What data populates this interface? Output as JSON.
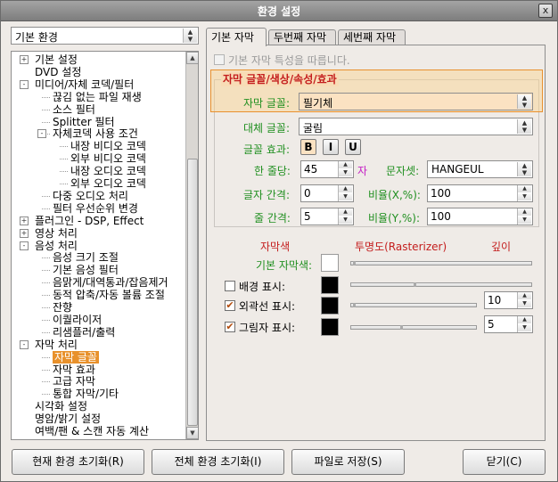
{
  "window": {
    "title": "환경 설정",
    "close_label": "x"
  },
  "category_combo": {
    "value": "기본 환경"
  },
  "tree": {
    "items": [
      {
        "label": "기본 설정",
        "level": 0,
        "expander": "+"
      },
      {
        "label": "DVD 설정",
        "level": 0,
        "expander": ""
      },
      {
        "label": "미디어/자체 코덱/필터",
        "level": 0,
        "expander": "-"
      },
      {
        "label": "끊김 없는 파일 재생",
        "level": 1,
        "expander": ""
      },
      {
        "label": "소스 필터",
        "level": 1,
        "expander": ""
      },
      {
        "label": "Splitter 필터",
        "level": 1,
        "expander": ""
      },
      {
        "label": "자체코덱 사용 조건",
        "level": 1,
        "expander": "-"
      },
      {
        "label": "내장 비디오 코덱",
        "level": 2,
        "expander": ""
      },
      {
        "label": "외부 비디오 코덱",
        "level": 2,
        "expander": ""
      },
      {
        "label": "내장 오디오 코덱",
        "level": 2,
        "expander": ""
      },
      {
        "label": "외부 오디오 코덱",
        "level": 2,
        "expander": ""
      },
      {
        "label": "다중 오디오 처리",
        "level": 1,
        "expander": ""
      },
      {
        "label": "필터 우선순위 변경",
        "level": 1,
        "expander": ""
      },
      {
        "label": "플러그인 - DSP, Effect",
        "level": 0,
        "expander": "+"
      },
      {
        "label": "영상 처리",
        "level": 0,
        "expander": "+"
      },
      {
        "label": "음성 처리",
        "level": 0,
        "expander": "-"
      },
      {
        "label": "음성 크기 조절",
        "level": 1,
        "expander": ""
      },
      {
        "label": "기본 음성 필터",
        "level": 1,
        "expander": ""
      },
      {
        "label": "음맑게/대역통과/잡음제거",
        "level": 1,
        "expander": ""
      },
      {
        "label": "동적 압축/자동 볼륨 조절",
        "level": 1,
        "expander": ""
      },
      {
        "label": "잔향",
        "level": 1,
        "expander": ""
      },
      {
        "label": "이퀄라이저",
        "level": 1,
        "expander": ""
      },
      {
        "label": "리샘플러/출력",
        "level": 1,
        "expander": ""
      },
      {
        "label": "자막 처리",
        "level": 0,
        "expander": "-"
      },
      {
        "label": "자막 글꼴",
        "level": 1,
        "expander": "",
        "selected": true
      },
      {
        "label": "자막 효과",
        "level": 1,
        "expander": ""
      },
      {
        "label": "고급 자막",
        "level": 1,
        "expander": ""
      },
      {
        "label": "통합 자막/기타",
        "level": 1,
        "expander": ""
      },
      {
        "label": "시각화 설정",
        "level": 0,
        "expander": ""
      },
      {
        "label": "명암/밝기 설정",
        "level": 0,
        "expander": ""
      },
      {
        "label": "여백/팬 & 스캔 자동 계산",
        "level": 0,
        "expander": ""
      }
    ]
  },
  "tabs": [
    {
      "label": "기본 자막",
      "active": true
    },
    {
      "label": "두번째 자막",
      "active": false
    },
    {
      "label": "세번째 자막",
      "active": false
    }
  ],
  "panel": {
    "inherit_label": "기본 자막 특성을 따릅니다.",
    "section_title": "자막 글꼴/색상/속성/효과",
    "font_label": "자막 글꼴:",
    "font_value": "필기체",
    "alt_font_label": "대체 글꼴:",
    "alt_font_value": "굴림",
    "effect_label": "글꼴 효과:",
    "bold": "B",
    "italic": "I",
    "underline": "U",
    "per_line_label": "한 줄당:",
    "per_line_value": "45",
    "per_line_unit": "자",
    "charset_label": "문자셋:",
    "charset_value": "HANGEUL",
    "char_spacing_label": "글자 간격:",
    "char_spacing_value": "0",
    "ratio_x_label": "비율(X,%):",
    "ratio_x_value": "100",
    "line_spacing_label": "줄 간격:",
    "line_spacing_value": "5",
    "ratio_y_label": "비율(Y,%):",
    "ratio_y_value": "100",
    "col_color": "자막색",
    "col_opacity": "투명도(Rasterizer)",
    "col_depth": "깊이",
    "base_color_label": "기본 자막색:",
    "bg_label": "배경 표시:",
    "outline_label": "외곽선 표시:",
    "outline_depth": "10",
    "shadow_label": "그림자 표시:",
    "shadow_depth": "5"
  },
  "colors": {
    "accent": "#e8912c",
    "label_green": "#1f8f1f",
    "header_red": "#c41e1e"
  },
  "buttons": {
    "reset_current": "현재 환경 초기화(R)",
    "reset_all": "전체 환경 초기화(I)",
    "save_file": "파일로 저장(S)",
    "close": "닫기(C)"
  }
}
